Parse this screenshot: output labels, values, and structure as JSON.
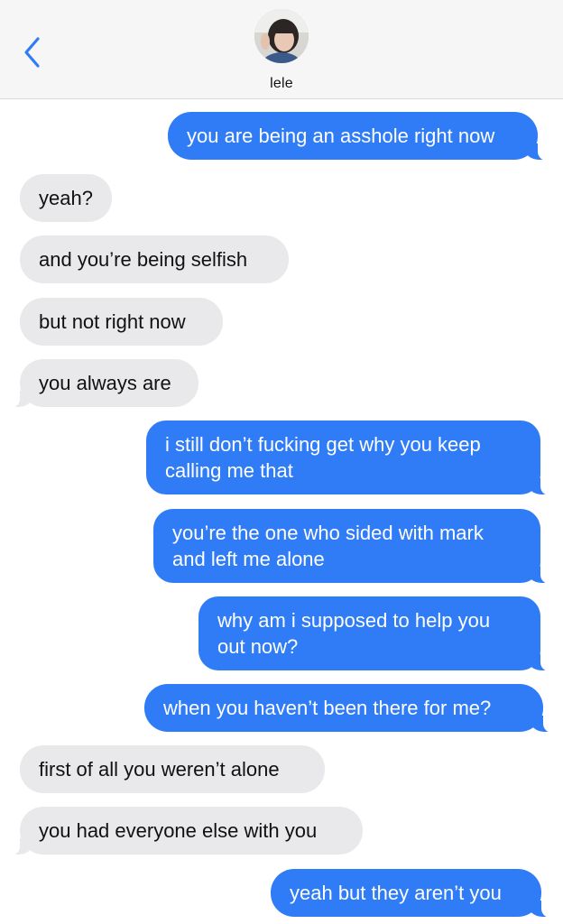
{
  "header": {
    "contact_name": "lele",
    "back_icon": "chevron-left-icon",
    "accent_color": "#2f7cf6"
  },
  "messages": [
    {
      "direction": "sent",
      "text": "you are being an asshole right now"
    },
    {
      "direction": "received",
      "text": "yeah?"
    },
    {
      "direction": "received",
      "text": "and you’re being selfish"
    },
    {
      "direction": "received",
      "text": "but not right now"
    },
    {
      "direction": "received",
      "text": "you always are"
    },
    {
      "direction": "sent",
      "text": "i still don’t fucking get why you keep calling me that"
    },
    {
      "direction": "sent",
      "text": "you’re the one who sided with mark and left me alone"
    },
    {
      "direction": "sent",
      "text": "why am i supposed to help you out now?"
    },
    {
      "direction": "sent",
      "text": "when you haven’t been there for me?"
    },
    {
      "direction": "received",
      "text": "first of all you weren’t alone"
    },
    {
      "direction": "received",
      "text": "you had everyone else with you"
    },
    {
      "direction": "sent",
      "text": "yeah but they aren’t you"
    }
  ],
  "colors": {
    "sent_bubble": "#2f7cf6",
    "received_bubble": "#e9e9eb",
    "header_background": "#f6f6f6"
  }
}
